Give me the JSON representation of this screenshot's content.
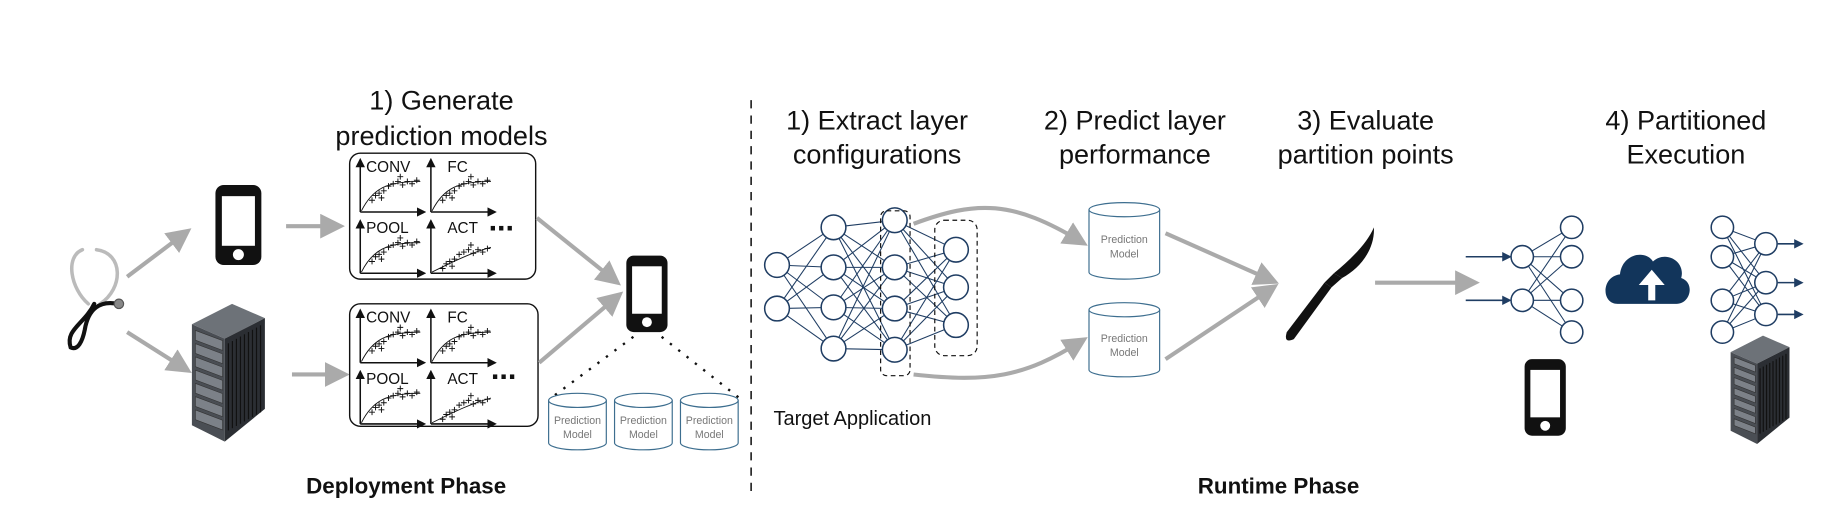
{
  "deployment": {
    "step1_line1": "1) Generate",
    "step1_line2": "prediction models",
    "plot_labels": [
      "CONV",
      "FC",
      "POOL",
      "ACT"
    ],
    "ellipsis": "...",
    "cylinder_line1": "Prediction",
    "cylinder_line2": "Model",
    "phase_label": "Deployment Phase"
  },
  "runtime": {
    "steps": [
      {
        "line1": "1) Extract layer",
        "line2": "configurations"
      },
      {
        "line1": "2) Predict layer",
        "line2": "performance"
      },
      {
        "line1": "3) Evaluate",
        "line2": "partition points"
      },
      {
        "line1": "4) Partitioned",
        "line2": "Execution"
      }
    ],
    "target_label": "Target Application",
    "cylinder_line1": "Prediction",
    "cylinder_line2": "Model",
    "phase_label": "Runtime Phase"
  },
  "icons": [
    "stethoscope-icon",
    "smartphone-icon",
    "server-rack-icon",
    "database-icon",
    "neural-network-icon",
    "scalpel-icon",
    "cloud-upload-icon"
  ],
  "colors": {
    "network": "#1f3d63",
    "arrow": "#aaaaaa",
    "cylinder": "#3d6e8f",
    "cloud": "#12355b"
  }
}
